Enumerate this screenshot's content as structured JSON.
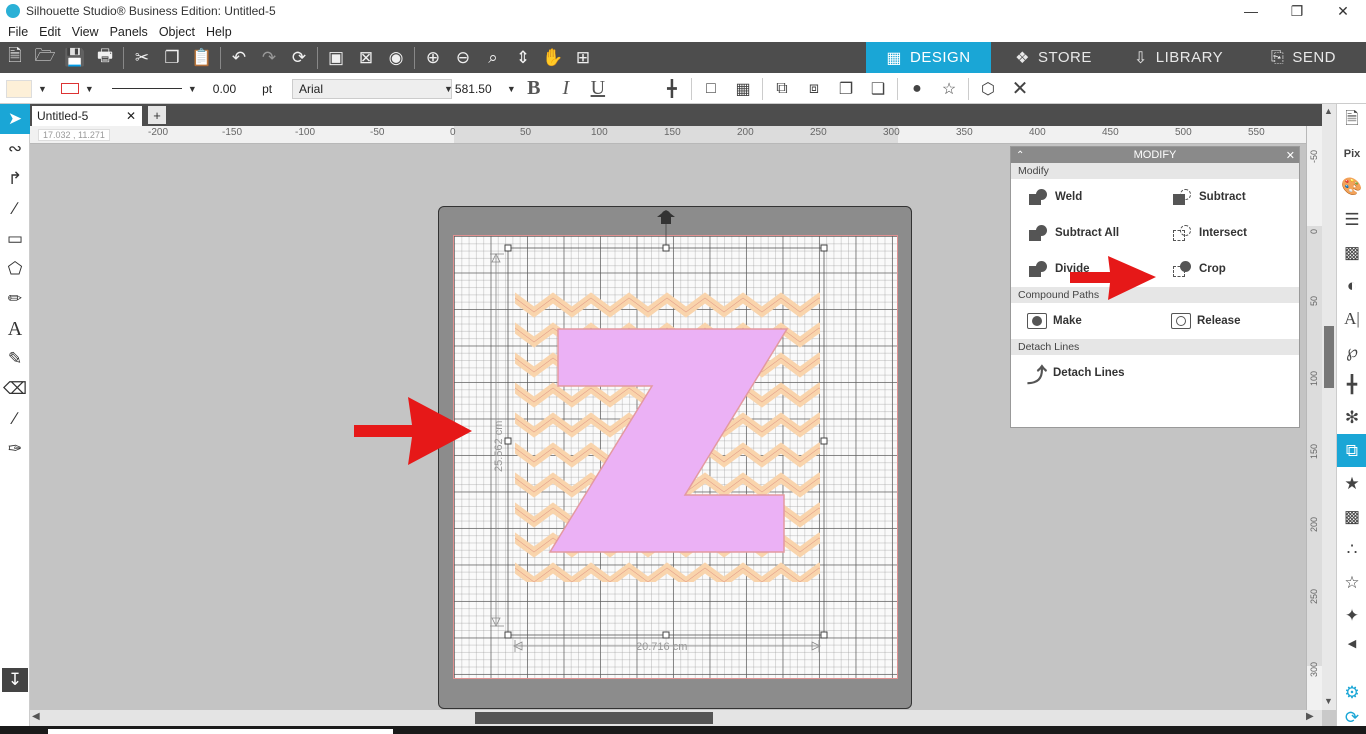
{
  "window": {
    "title": "Silhouette Studio® Business Edition: Untitled-5",
    "controls": [
      "—",
      "❐",
      "✕"
    ]
  },
  "menu": [
    "File",
    "Edit",
    "View",
    "Panels",
    "Object",
    "Help"
  ],
  "modes": [
    {
      "label": "DESIGN",
      "icon": "grid-icon",
      "active": true
    },
    {
      "label": "STORE",
      "icon": "store-icon",
      "active": false
    },
    {
      "label": "LIBRARY",
      "icon": "library-icon",
      "active": false
    },
    {
      "label": "SEND",
      "icon": "send-icon",
      "active": false
    }
  ],
  "toolbar2": {
    "line_width": "0.00",
    "line_unit": "pt",
    "font_name": "Arial",
    "font_size": "581.50",
    "bold": "B",
    "italic": "I",
    "underline": "U"
  },
  "doc_tab": {
    "name": "Untitled-5",
    "close": "✕",
    "add": "+"
  },
  "ruler": {
    "coord": "17.032 , 11.271",
    "h_ticks": [
      "-200",
      "-150",
      "-100",
      "-50",
      "0",
      "50",
      "100",
      "150",
      "200",
      "250",
      "300",
      "350",
      "400",
      "450",
      "500",
      "550"
    ],
    "v_ticks": [
      "-50",
      "0",
      "50",
      "100",
      "150",
      "200",
      "250",
      "300"
    ]
  },
  "canvas": {
    "letter": "Z",
    "height_label": "25.562 cm",
    "width_label": "20.716 cm",
    "colors": {
      "letter_fill": "#ebb1f5",
      "letter_stroke": "#e39aa0",
      "chevron_fill": "#f9d4ac",
      "chevron_stroke": "#e4a08a",
      "arrow": "#e61818"
    }
  },
  "modify_panel": {
    "title": "MODIFY",
    "sections": {
      "modify": "Modify",
      "compound": "Compound Paths",
      "detach": "Detach Lines"
    },
    "buttons": {
      "weld": "Weld",
      "subtract": "Subtract",
      "subtract_all": "Subtract All",
      "intersect": "Intersect",
      "divide": "Divide",
      "crop": "Crop",
      "make": "Make",
      "release": "Release",
      "detach_lines": "Detach Lines"
    }
  }
}
